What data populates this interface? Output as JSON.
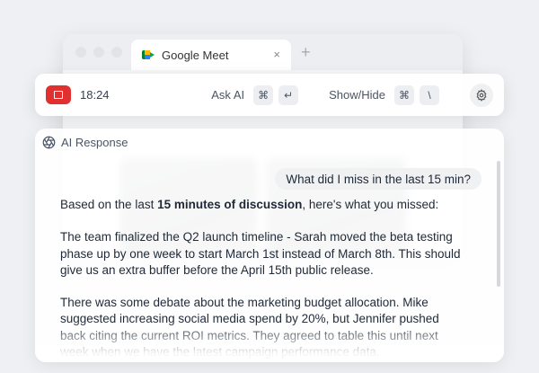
{
  "browser": {
    "tab_title": "Google Meet",
    "tab_close": "×",
    "new_tab": "+"
  },
  "controlbar": {
    "timer": "18:24",
    "ask_ai_label": "Ask AI",
    "ask_ai_keys": [
      "⌘",
      "↵"
    ],
    "show_hide_label": "Show/Hide",
    "show_hide_keys": [
      "⌘",
      "\\"
    ]
  },
  "panel": {
    "title": "AI Response",
    "user_message": "What did I miss in the last 15 min?",
    "intro_pre": "Based on the last ",
    "intro_bold": "15 minutes of discussion",
    "intro_post": ", here's what you missed:",
    "paragraph_1": "The team finalized the Q2 launch timeline - Sarah moved the beta testing phase up by one week to start March 1st instead of March 8th. This should give us an extra buffer before the April 15th public release.",
    "paragraph_2": "There was some debate about the marketing budget allocation. Mike suggested increasing social media spend by 20%, but Jennifer pushed back citing the current ROI metrics. They agreed to table this until next week when we have the latest campaign performance data."
  },
  "colors": {
    "stop_button": "#e03030",
    "meet_green": "#00832d",
    "meet_yellow": "#ffba00",
    "meet_blue": "#2684fc"
  },
  "icons": {
    "stop": "stop-icon",
    "settings": "gear-icon",
    "panel": "aperture-icon",
    "tab": "google-meet-icon"
  }
}
